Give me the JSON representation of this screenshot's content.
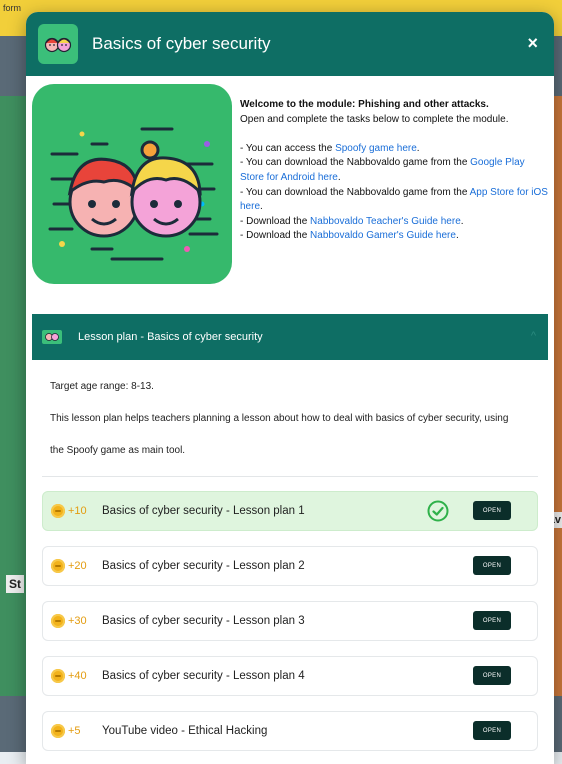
{
  "background": {
    "top_text": "form",
    "side_left": "St",
    "side_right": "av"
  },
  "modal": {
    "title": "Basics of cyber security",
    "close_label": "×",
    "intro": {
      "welcome": "Welcome to the module:   Phishing and other attacks.",
      "instructions": "Open and complete the tasks below to complete the module.",
      "spoofy_prefix": "- You can access the ",
      "spoofy_link": "Spoofy game here",
      "spoofy_suffix": ".",
      "gplay_prefix": "- You can download the Nabbovaldo game from the ",
      "gplay_link": "Google Play Store for Android here",
      "gplay_suffix": ".",
      "appstore_prefix": "- You can download the Nabbovaldo game from the ",
      "appstore_link": "App Store for iOS here",
      "appstore_suffix": ".",
      "teacher_prefix": "- Download the ",
      "teacher_link": "Nabbovaldo Teacher's Guide here",
      "teacher_suffix": ".",
      "gamer_prefix": "- Download the ",
      "gamer_link": "Nabbovaldo Gamer's Guide here",
      "gamer_suffix": "."
    },
    "lesson": {
      "title": "Lesson plan - Basics of cyber security",
      "age_range": "Target age range: 8-13.",
      "description_line1": "This lesson plan helps teachers planning a lesson about how to deal with basics of cyber security, using",
      "description_line2": "the  Spoofy game as main tool."
    },
    "tasks": [
      {
        "points": "+10",
        "title": "Basics of cyber security - Lesson plan 1",
        "button": "OPEN",
        "completed": true
      },
      {
        "points": "+20",
        "title": "Basics of cyber security - Lesson plan 2",
        "button": "OPEN",
        "completed": false
      },
      {
        "points": "+30",
        "title": "Basics of cyber security - Lesson plan 3",
        "button": "OPEN",
        "completed": false
      },
      {
        "points": "+40",
        "title": "Basics of cyber security - Lesson plan 4",
        "button": "OPEN",
        "completed": false
      },
      {
        "points": "+5",
        "title": "YouTube video - Ethical Hacking",
        "button": "OPEN",
        "completed": false
      }
    ]
  },
  "colors": {
    "header": "#0e6e64",
    "accent_green": "#3bbf7a",
    "link": "#1a6ed8",
    "points": "#e39c10",
    "done_row": "#dff5de",
    "open_button": "#0b2e2a"
  },
  "icons": {
    "header": "kids-faces-icon",
    "close": "close-icon",
    "coin": "coin-icon",
    "check": "check-circle-icon",
    "chevron": "chevron-up-icon"
  }
}
